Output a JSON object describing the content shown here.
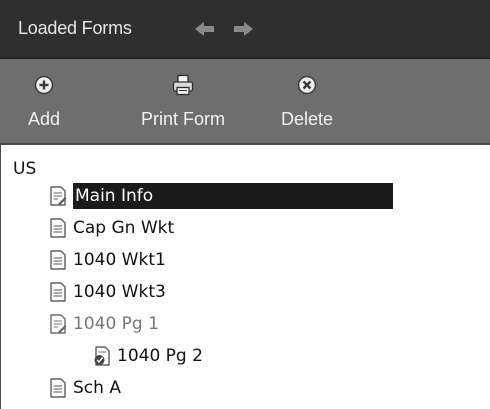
{
  "panel": {
    "title": "Loaded Forms"
  },
  "toolbar": {
    "add_label": "Add",
    "print_label": "Print Form",
    "delete_label": "Delete"
  },
  "tree": {
    "root_label": "US",
    "items": [
      {
        "label": "Main Info",
        "icon": "form-edit-icon",
        "selected": true
      },
      {
        "label": "Cap Gn Wkt",
        "icon": "document-icon"
      },
      {
        "label": "1040 Wkt1",
        "icon": "document-icon"
      },
      {
        "label": "1040 Wkt3",
        "icon": "document-icon"
      },
      {
        "label": "1040 Pg 1",
        "icon": "form-edit-icon",
        "muted": true
      },
      {
        "label": "1040 Pg 2",
        "icon": "form-check-icon",
        "indented": true
      },
      {
        "label": "Sch A",
        "icon": "document-icon"
      }
    ]
  },
  "colors": {
    "titlebar": "#2f2f2f",
    "toolbar": "#6e6e6e",
    "selection": "#1b1b1b"
  }
}
